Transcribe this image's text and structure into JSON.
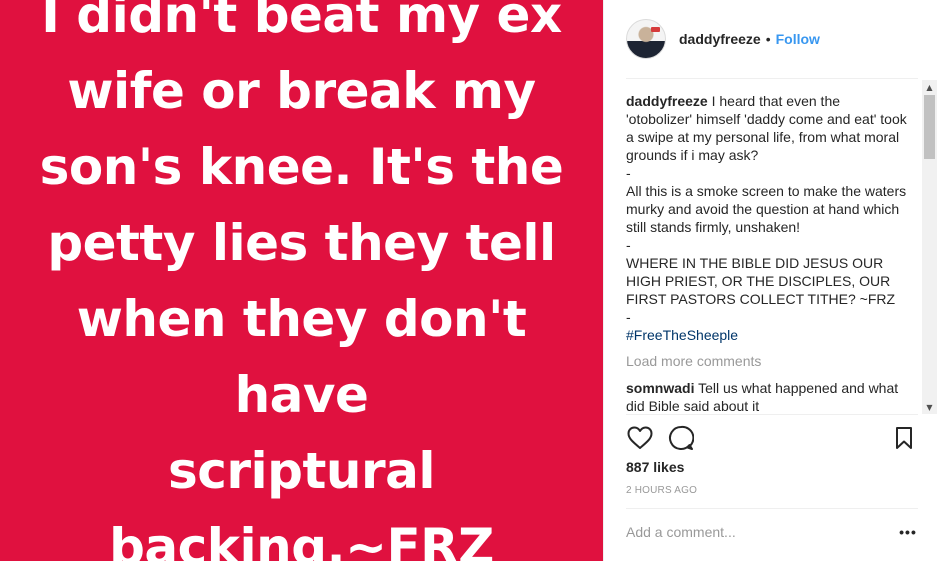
{
  "post": {
    "image_text": "I didn't beat my ex\nwife or break my\nson's knee. It's the\npetty lies they tell\nwhen they don't have\nscriptural\nbacking.~FRZ",
    "background_color": "#e0113f"
  },
  "header": {
    "username": "daddyfreeze",
    "separator": "•",
    "follow_label": "Follow"
  },
  "caption": {
    "username": "daddyfreeze",
    "lines": [
      "I heard that even the 'otobolizer' himself 'daddy come and eat' took a swipe at my personal life, from what moral grounds if i may ask?",
      "-",
      "All this is a smoke screen to make the waters murky and avoid the question at hand which still stands firmly, unshaken!",
      "-",
      "WHERE IN THE BIBLE DID JESUS OUR HIGH PRIEST, OR THE DISCIPLES, OUR FIRST PASTORS COLLECT TITHE? ~FRZ",
      "-"
    ],
    "hashtag": "#FreeTheSheeple"
  },
  "load_more": "Load more comments",
  "comments": [
    {
      "username": "somnwadi",
      "text": "Tell us what happened and what did Bible said about it"
    }
  ],
  "actions": {
    "like_icon": "heart-icon",
    "comment_icon": "comment-bubble-icon",
    "save_icon": "bookmark-icon"
  },
  "likes": "887 likes",
  "timestamp": "2 HOURS AGO",
  "comment_box": {
    "placeholder": "Add a comment...",
    "more_label": "•••"
  },
  "colors": {
    "accent": "#3897f0",
    "hashtag": "#003569",
    "muted": "#999999"
  }
}
